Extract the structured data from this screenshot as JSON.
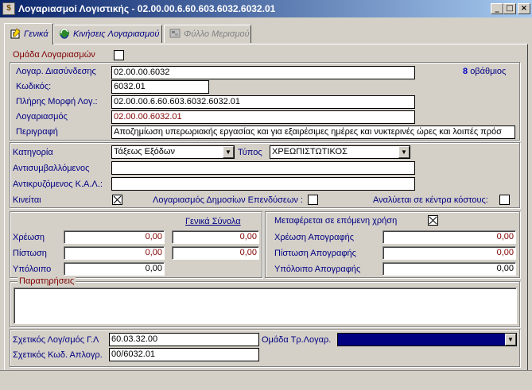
{
  "window": {
    "title": "Λογαριασμοί Λογιστικής - 02.00.00.6.60.603.6032.6032.01",
    "minimize": "_",
    "maximize": "□",
    "close": "×"
  },
  "tabs": [
    {
      "label": "Γενικά"
    },
    {
      "label": "Κινήσεις Λογαριασμού"
    },
    {
      "label": "Φύλλο Μερισμού"
    }
  ],
  "general": {
    "group_label": "Ομάδα Λογαριασμών",
    "link_account_label": "Λογαρ. Διασύνδεσης",
    "link_account_value": "02.00.00.6032",
    "level_value": "8",
    "level_label": "οβάθμιος",
    "code_label": "Κωδικός:",
    "code_value": "6032.01",
    "full_form_label": "Πλήρης Μορφή Λογ.:",
    "full_form_value": "02.00.00.6.60.603.6032.6032.01",
    "account_label": "Λογαριασμός",
    "account_value": "02.00.00.6032.01",
    "description_label": "Περιγραφή",
    "description_value": "Αποζημίωση υπερωριακής εργασίας και για εξαιρέσιμες ημέρες και νυκτερινές ώρες και λοιπές πρόσ"
  },
  "category": {
    "category_label": "Κατηγορία",
    "category_value": "Τάξεως Εξόδων",
    "type_label": "Τύπος",
    "type_value": "ΧΡΕΩΠΙΣΤΩΤΙΚΟΣ",
    "counter_party_label": "Αντισυμβαλλόμενος",
    "counter_party_value": "",
    "counter_kal_label": "Αντικρυζόμενος Κ.Α.Λ.:",
    "counter_kal_value": "",
    "moves_label": "Κινείται",
    "moves_checked": true,
    "public_investments_label": "Λογαριασμός Δημοσίων Επενδύσεων :",
    "public_investments_checked": false,
    "cost_centers_label": "Αναλύεται σε κέντρα κόστους:",
    "cost_centers_checked": false
  },
  "balances": {
    "totals_link": "Γενικά Σύνολα",
    "debit_label": "Χρέωση",
    "debit_value": "0,00",
    "debit_total": "0,00",
    "credit_label": "Πίστωση",
    "credit_value": "0,00",
    "credit_total": "0,00",
    "balance_label": "Υπόλοιπο",
    "balance_value": "0,00"
  },
  "inventory": {
    "carry_over_label": "Μεταφέρεται σε επόμενη χρήση",
    "carry_over_checked": true,
    "debit_label": "Χρέωση Απογραφής",
    "debit_value": "0,00",
    "credit_label": "Πίστωση Απογραφής",
    "credit_value": "0,00",
    "balance_label": "Υπόλοιπο Απογραφής",
    "balance_value": "0,00"
  },
  "notes": {
    "label": "Παρατηρήσεις",
    "value": ""
  },
  "related": {
    "gl_label": "Σχετικός Λογ/σμός Γ.Λ",
    "gl_value": "60.03.32.00",
    "group_label": "Ομάδα Τρ.Λογαρ.",
    "group_value": "",
    "code_label": "Σχετικός Κωδ. Απλογρ.",
    "code_value": "00/6032.01"
  }
}
